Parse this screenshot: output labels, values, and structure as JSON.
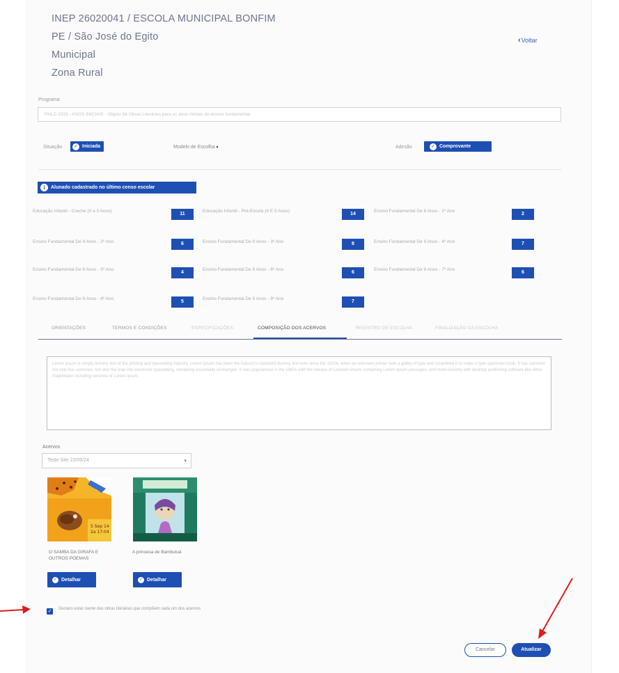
{
  "school": {
    "inep_line": "INEP 26020041 / ESCOLA MUNICIPAL BONFIM",
    "location": "PE / São José do Egito",
    "network": "Municipal",
    "zone": "Zona Rural"
  },
  "back_link": {
    "label": "Voltar"
  },
  "programa": {
    "label": "Programa",
    "value": "PNLD 2023 - ANOS INICIAIS - Objeto 3A Obras Literárias para os anos iniciais do ensino fundamental"
  },
  "status": {
    "situacao_label": "Situação",
    "situacao_value": "Iniciada",
    "modelo_label": "Modelo de Escolha",
    "adesao_label": "Adesão",
    "adesao_value": "Comprovante"
  },
  "alunos_banner": "Alunado cadastrado no último censo escolar",
  "grades": [
    {
      "label": "Educação Infantil - Creche (0 a 3 Anos)",
      "value": "11"
    },
    {
      "label": "Educação Infantil - Pré-Escola (4 E 5 Anos)",
      "value": "14"
    },
    {
      "label": "Ensino Fundamental De 9 Anos - 1º Ano",
      "value": "2"
    },
    {
      "label": "Ensino Fundamental De 9 Anos - 2º Ano",
      "value": "6"
    },
    {
      "label": "Ensino Fundamental De 9 Anos - 3º Ano",
      "value": "8"
    },
    {
      "label": "Ensino Fundamental De 9 Anos - 4º Ano",
      "value": "7"
    },
    {
      "label": "Ensino Fundamental De 9 Anos - 5º Ano",
      "value": "4"
    },
    {
      "label": "Ensino Fundamental De 9 Anos - 6º Ano",
      "value": "6"
    },
    {
      "label": "Ensino Fundamental De 9 Anos - 7º Ano",
      "value": "6"
    },
    {
      "label": "Ensino Fundamental De 9 Anos - 8º Ano",
      "value": "5"
    },
    {
      "label": "Ensino Fundamental De 9 Anos - 9º Ano",
      "value": "7"
    }
  ],
  "tabs": [
    {
      "label": "ORIENTAÇÕES"
    },
    {
      "label": "TERMOS E CONDIÇÕES"
    },
    {
      "label": "ESPECIFICAÇÕES"
    },
    {
      "label": "COMPOSIÇÃO DOS ACERVOS"
    },
    {
      "label": "REGISTRO DE ESCOLHA"
    },
    {
      "label": "FINALIZAÇÃO DA ESCOLHA"
    }
  ],
  "description": "Lorem ipsum is simply dummy text of the printing and typesetting industry. Lorem Ipsum has been the industry's standard dummy text ever since the 1500s, when an unknown printer took a galley of type and scrambled it to make a type specimen book. It has survived not only five centuries, but also the leap into electronic typesetting, remaining essentially unchanged. It was popularised in the 1960s with the release of Letraset sheets containing Lorem Ipsum passages, and more recently with desktop publishing software like Aldus PageMaker including versions of Lorem Ipsum.",
  "acervos": {
    "label": "Acervos",
    "selected": "Teste Site 22/05/24"
  },
  "books": [
    {
      "title": "O SAMBA DA GIRAFA E OUTROS POEMAS",
      "button": "Detalhar",
      "cover_text": "5 Sep 14\n2a 17:04"
    },
    {
      "title": "A princesa de Bambuluá",
      "button": "Detalhar"
    }
  ],
  "declaration": "Declaro estar ciente das obras literárias que compõem cada um dos acervos",
  "actions": {
    "cancel": "Cancelar",
    "update": "Atualizar"
  },
  "colors": {
    "primary": "#1e4fb3",
    "annotation": "#e11a1a"
  }
}
